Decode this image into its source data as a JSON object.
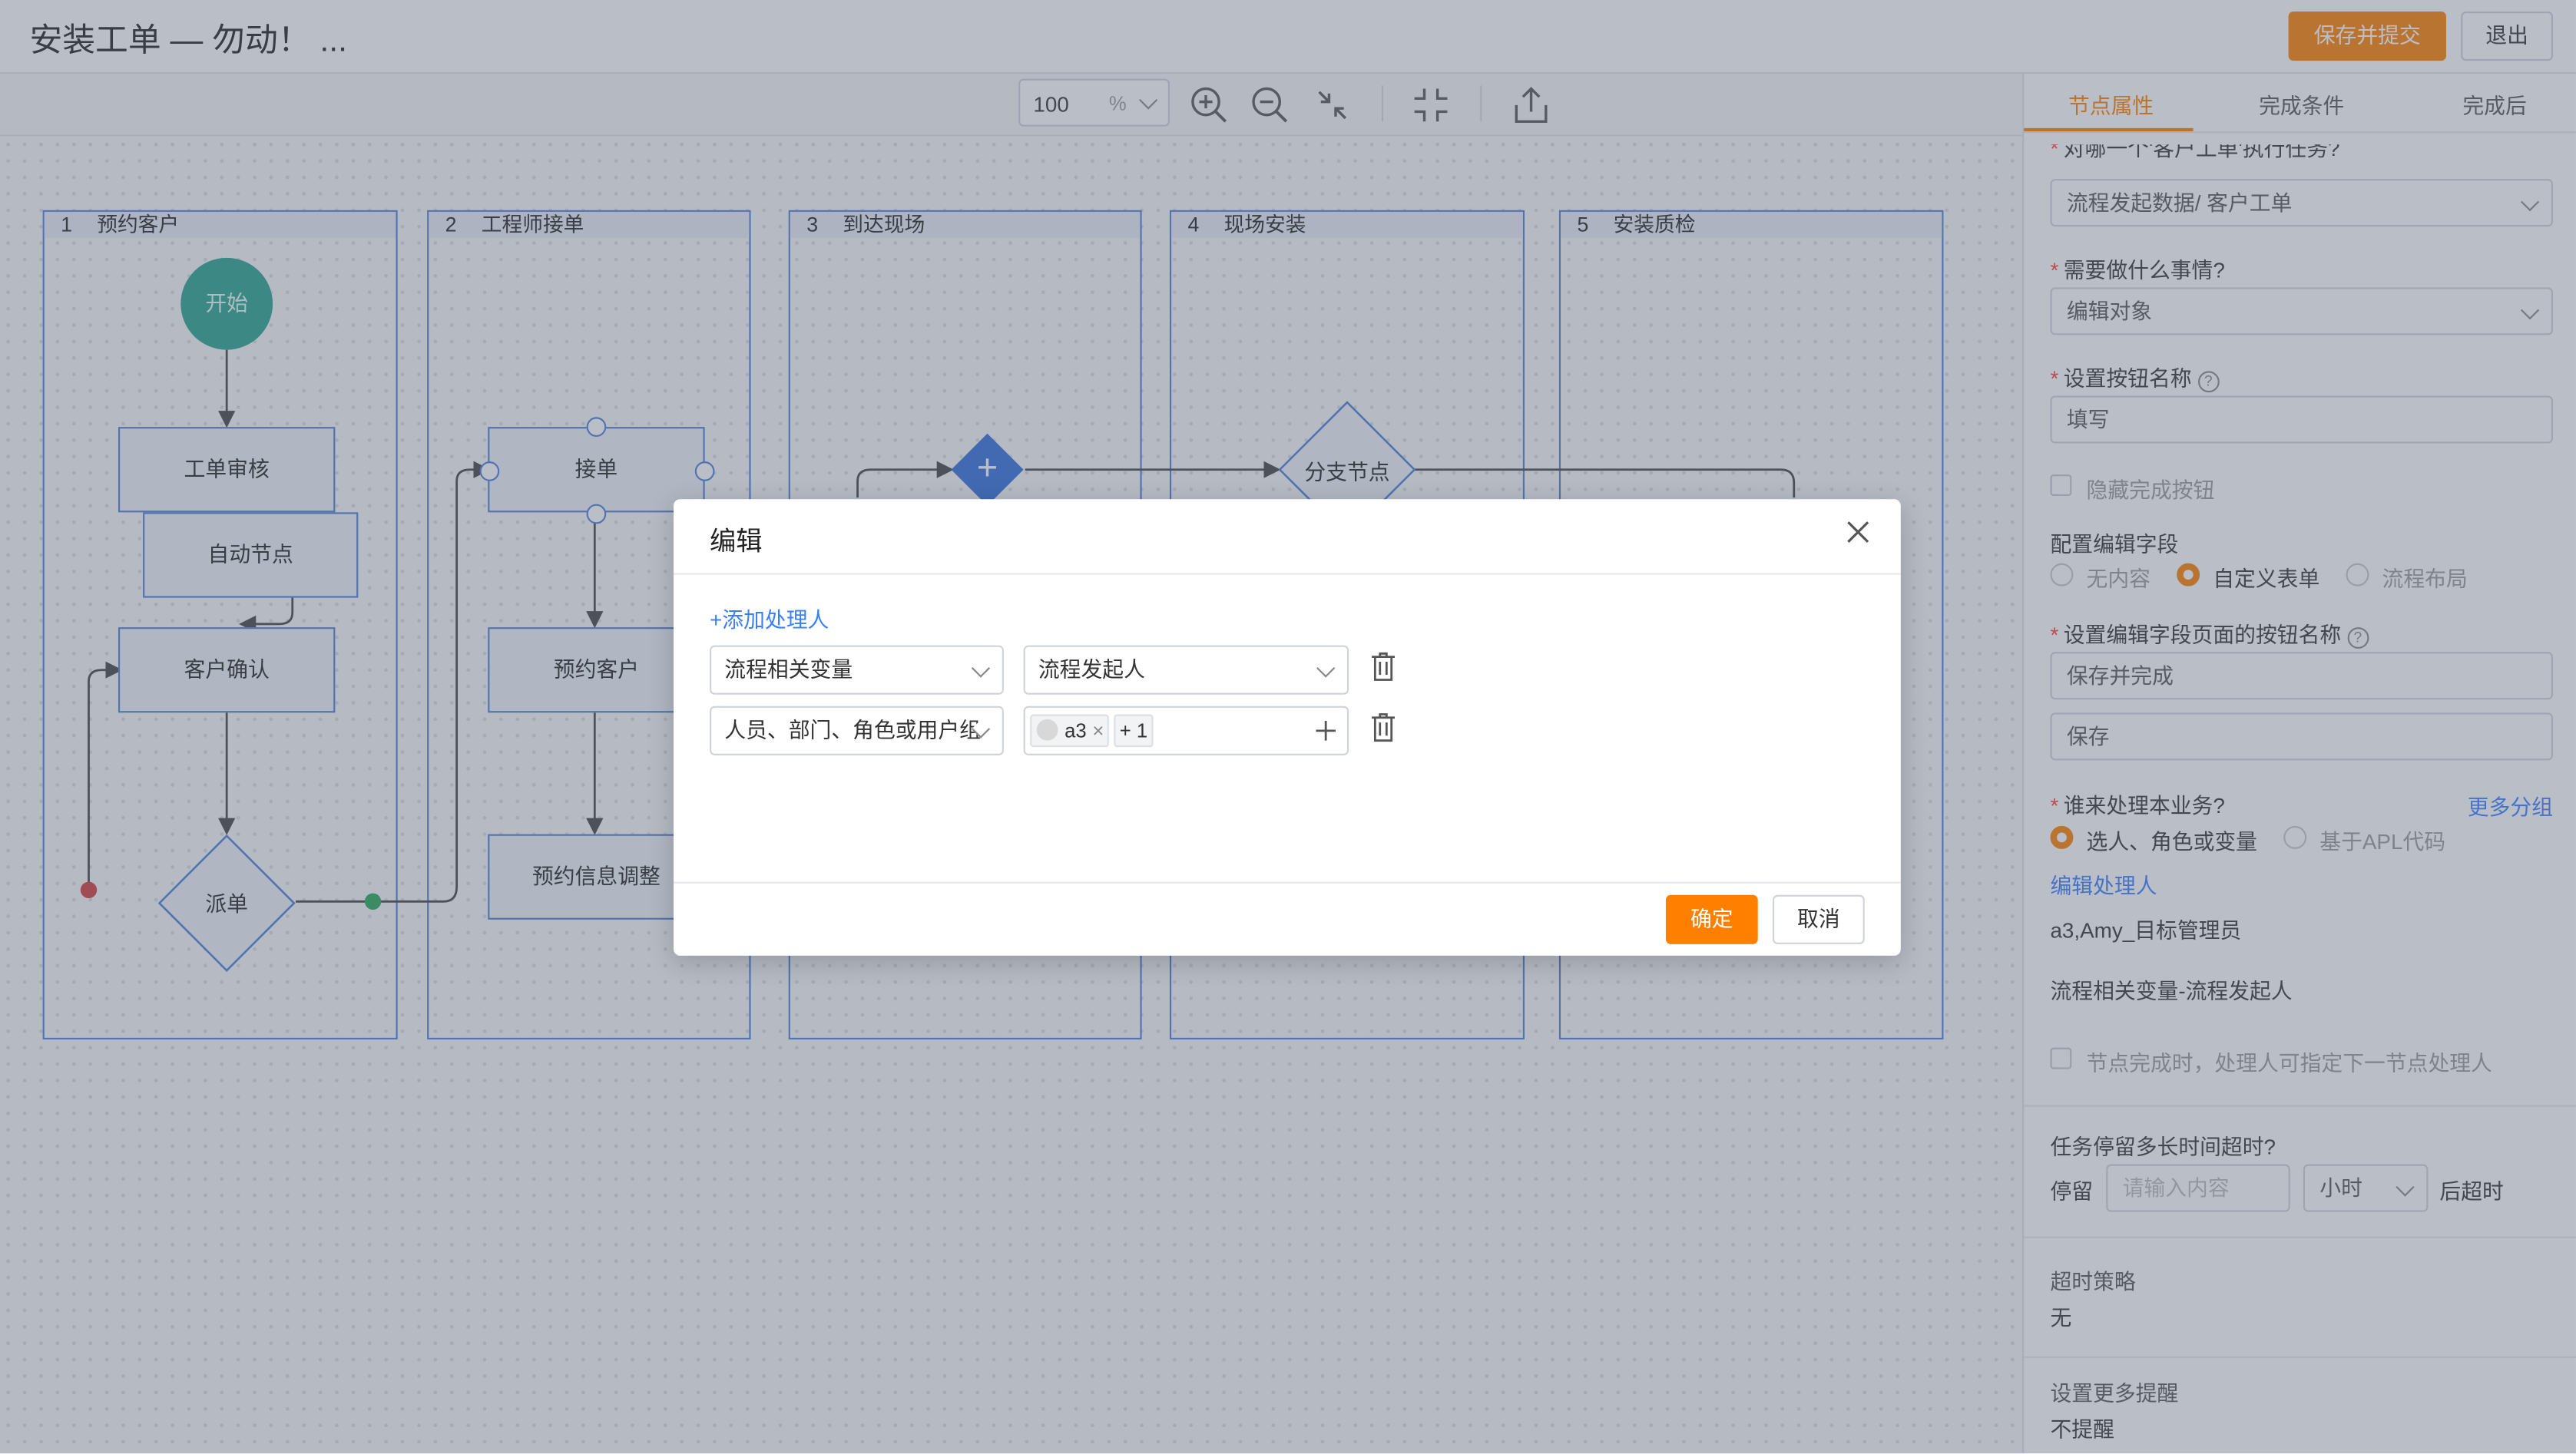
{
  "header": {
    "title": "安装工单 — 勿动！ ...",
    "save_submit": "保存并提交",
    "exit": "退出"
  },
  "toolbar": {
    "zoom_value": "100",
    "zoom_unit": "%"
  },
  "lanes": [
    {
      "num": "1",
      "name": "预约客户"
    },
    {
      "num": "2",
      "name": "工程师接单"
    },
    {
      "num": "3",
      "name": "到达现场"
    },
    {
      "num": "4",
      "name": "现场安装"
    },
    {
      "num": "5",
      "name": "安装质检"
    }
  ],
  "nodes": {
    "start": "开始",
    "review": "工单审核",
    "auto": "自动节点",
    "confirm": "客户确认",
    "dispatch": "派单",
    "accept": "接单",
    "appoint": "预约客户",
    "adjust": "预约信息调整",
    "branch": "分支节点",
    "plus": "+"
  },
  "panel": {
    "tabs": [
      "节点属性",
      "完成条件",
      "完成后"
    ],
    "q_object": "对哪一个'客户工单'执行任务?",
    "object_value": "流程发起数据/ 客户工单",
    "q_action": "需要做什么事情?",
    "action_value": "编辑对象",
    "q_button": "设置按钮名称",
    "button_placeholder": "填写",
    "hide_button": "隐藏完成按钮",
    "config_fields": "配置编辑字段",
    "field_options": [
      "无内容",
      "自定义表单",
      "流程布局"
    ],
    "q_page_button": "设置编辑字段页面的按钮名称",
    "page_button_1": "保存并完成",
    "page_button_2": "保存",
    "q_who": "谁来处理本业务?",
    "more_groups": "更多分组",
    "who_options": [
      "选人、角色或变量",
      "基于APL代码"
    ],
    "edit_handler": "编辑处理人",
    "handler_list_1": "a3,Amy_目标管理员",
    "handler_list_2": "流程相关变量-流程发起人",
    "next_handler": "节点完成时，处理人可指定下一节点处理人",
    "q_timeout": "任务停留多长时间超时?",
    "stay": "停留",
    "stay_placeholder": "请输入内容",
    "unit": "小时",
    "after_timeout": "后超时",
    "timeout_policy": "超时策略",
    "timeout_value": "无",
    "more_remind": "设置更多提醒",
    "remind_value": "不提醒"
  },
  "modal": {
    "title": "编辑",
    "add_handler": "+添加处理人",
    "row1_type": "流程相关变量",
    "row1_value": "流程发起人",
    "row2_type": "人员、部门、角色或用户组",
    "row2_tag": "a3",
    "row2_more": "+ 1",
    "ok": "确定",
    "cancel": "取消"
  },
  "colors": {
    "accent": "#ff8000",
    "link": "#3a7fff",
    "lane_border": "#4a7fd8",
    "start_node": "#27a390"
  }
}
